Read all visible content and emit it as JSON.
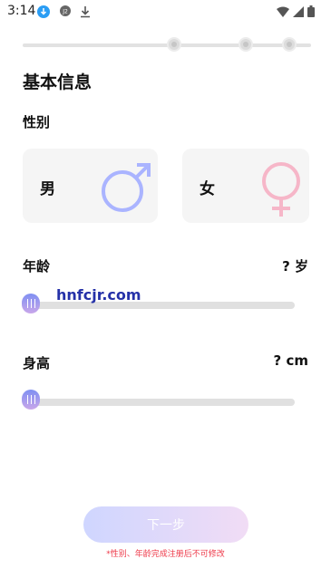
{
  "status_bar": {
    "time": "3:14",
    "notification_icons": [
      "download-circle-icon",
      "app-badge-icon",
      "download-icon"
    ],
    "system_icons": [
      "wifi-icon",
      "signal-icon",
      "battery-icon"
    ]
  },
  "progress": {
    "steps": 3,
    "current_step": 0
  },
  "page": {
    "title": "基本信息"
  },
  "gender": {
    "label": "性别",
    "options": [
      {
        "label": "男",
        "icon": "male-symbol-icon",
        "color": "#aab4ff"
      },
      {
        "label": "女",
        "icon": "female-symbol-icon",
        "color": "#f6b6c8"
      }
    ]
  },
  "age": {
    "label": "年龄",
    "value_text": "? 岁",
    "slider_value": 0
  },
  "height": {
    "label": "身高",
    "value_text": "? cm",
    "slider_value": 0
  },
  "watermark": "hnfcjr.com",
  "next_button": {
    "label": "下一步"
  },
  "note": "*性别、年龄完成注册后不可修改",
  "colors": {
    "accent": "#8a95f4",
    "note": "#ee3a4a"
  }
}
